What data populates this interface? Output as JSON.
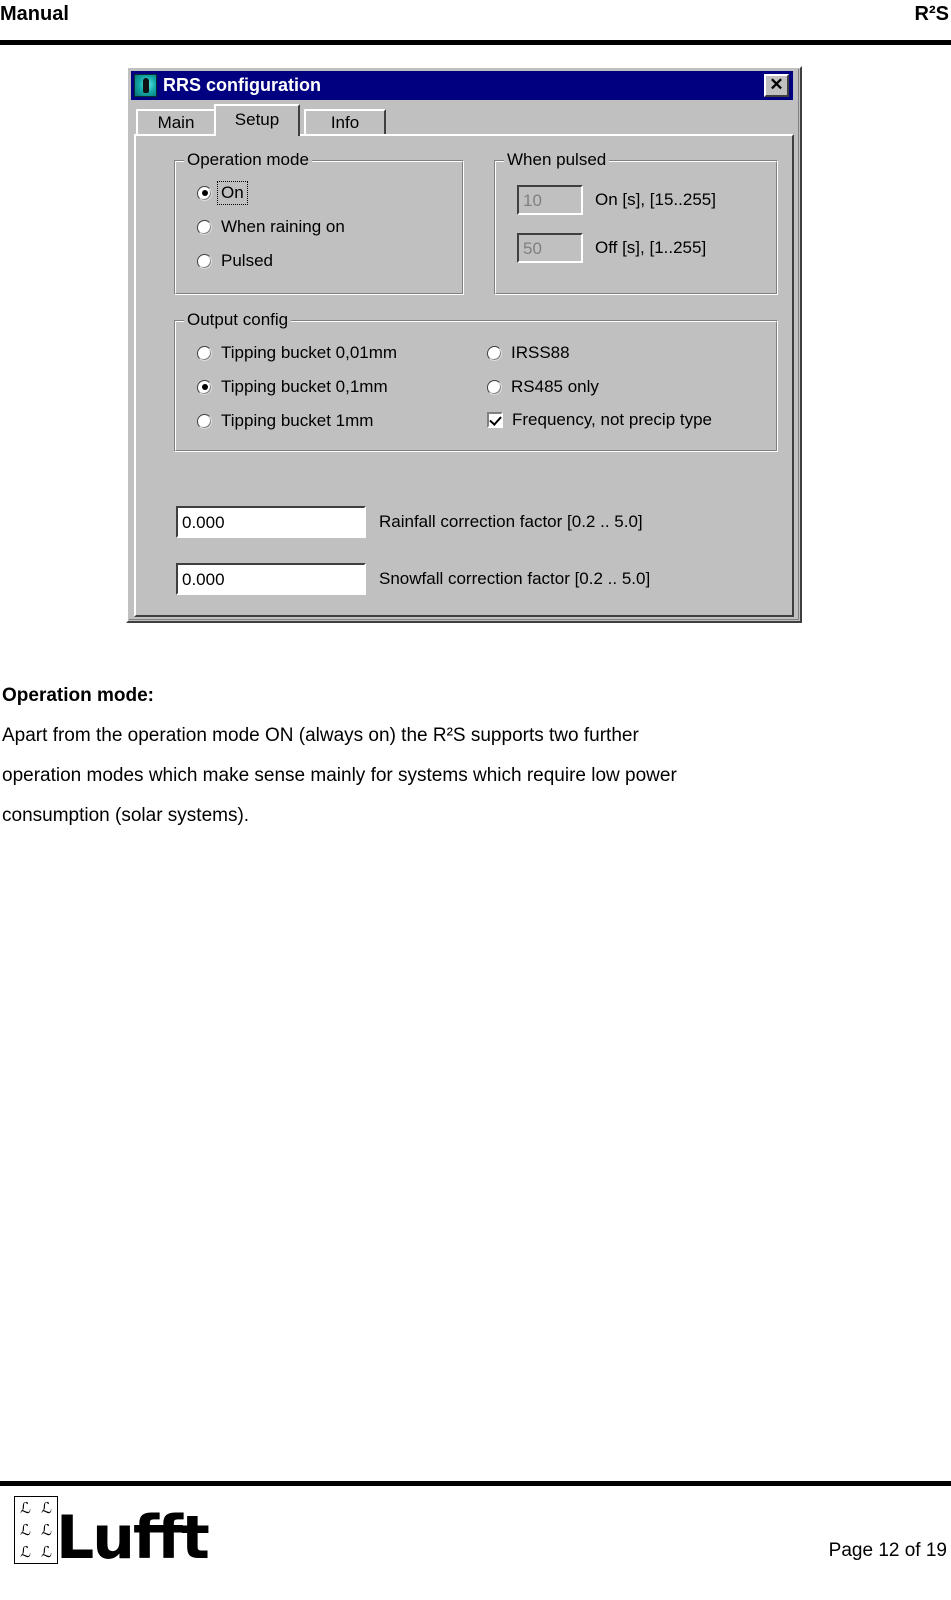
{
  "page": {
    "header_left": "Manual",
    "header_right": "R²S",
    "footer_page": "Page 12 of 19",
    "logo_word": "Lufft",
    "logo_pattern_glyph": "ℒ"
  },
  "dialog": {
    "title": "RRS configuration",
    "title_icon": "sensor-icon",
    "close_label": "✕",
    "tabs": [
      {
        "label": "Main",
        "active": false
      },
      {
        "label": "Setup",
        "active": true
      },
      {
        "label": "Info",
        "active": false
      }
    ],
    "operation_mode": {
      "legend": "Operation mode",
      "options": [
        {
          "label": "On",
          "checked": true,
          "focused": true
        },
        {
          "label": "When raining on",
          "checked": false,
          "focused": false
        },
        {
          "label": "Pulsed",
          "checked": false,
          "focused": false
        }
      ]
    },
    "when_pulsed": {
      "legend": "When pulsed",
      "fields": [
        {
          "value": "10",
          "label": "On [s], [15..255]",
          "disabled": true
        },
        {
          "value": "50",
          "label": "Off [s], [1..255]",
          "disabled": true
        }
      ]
    },
    "output_config": {
      "legend": "Output config",
      "left_options": [
        {
          "label": "Tipping bucket 0,01mm",
          "checked": false
        },
        {
          "label": "Tipping bucket 0,1mm",
          "checked": true
        },
        {
          "label": "Tipping bucket 1mm",
          "checked": false
        }
      ],
      "right_options": [
        {
          "type": "radio",
          "label": "IRSS88",
          "checked": false
        },
        {
          "type": "radio",
          "label": "RS485 only",
          "checked": false
        },
        {
          "type": "checkbox",
          "label": "Frequency, not precip type",
          "checked": true
        }
      ]
    },
    "correction_factors": [
      {
        "value": "0.000",
        "label": "Rainfall correction factor [0.2 .. 5.0]"
      },
      {
        "value": "0.000",
        "label": "Snowfall correction factor [0.2 .. 5.0]"
      }
    ]
  },
  "body": {
    "heading": "Operation mode:",
    "lines": [
      "Apart from the operation mode ON (always on) the R²S supports two further",
      "operation modes which make sense mainly for systems which require low power",
      "consumption (solar systems)."
    ]
  },
  "colors": {
    "titlebar": "#000080",
    "dialog_face": "#c0c0c0",
    "rule": "#000000"
  }
}
